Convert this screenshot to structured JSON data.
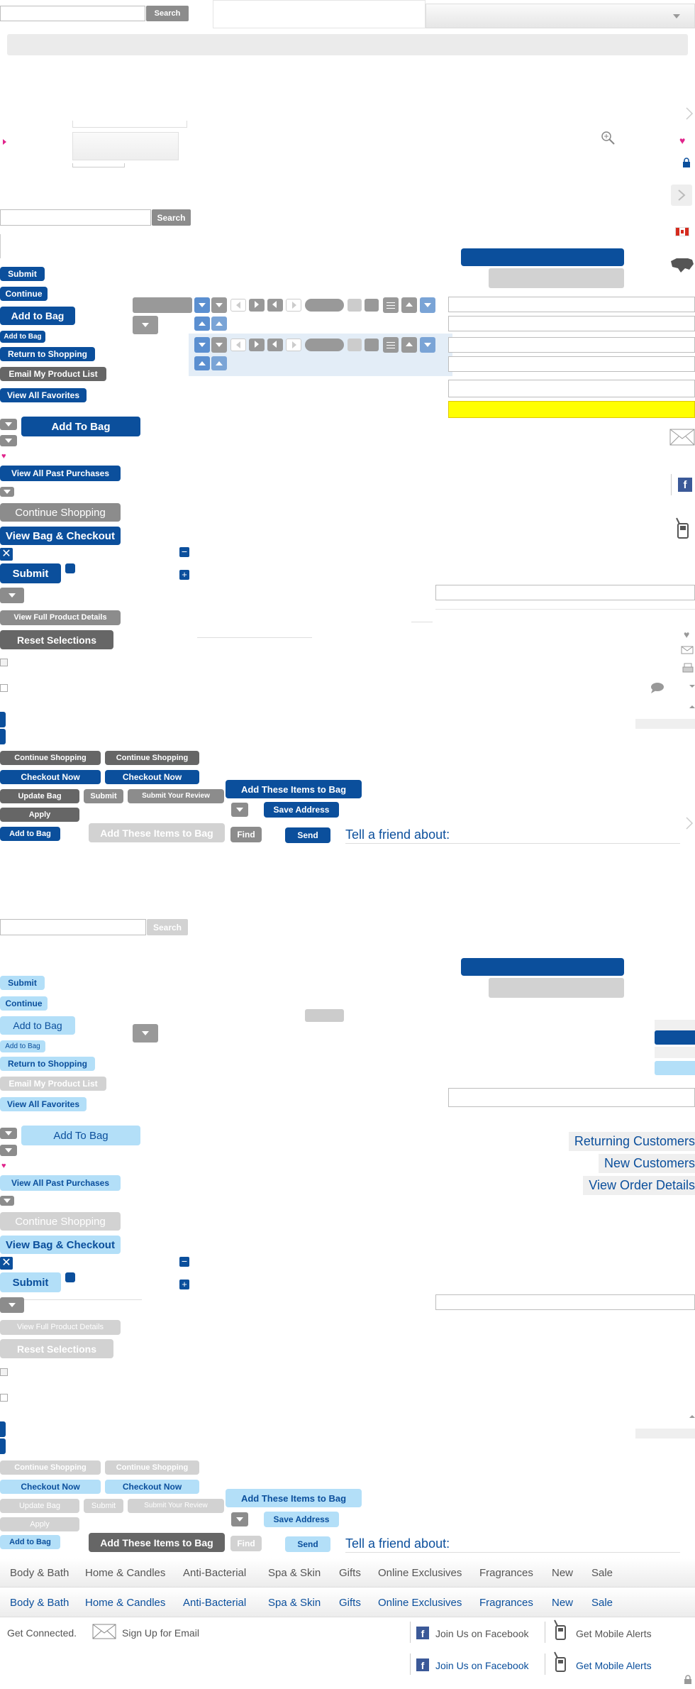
{
  "search": {
    "button": "Search"
  },
  "buttons_a": {
    "submit": "Submit",
    "continue": "Continue",
    "add_to_bag": "Add to Bag",
    "add_to_bag_small": "Add to Bag",
    "return_to_shopping": "Return to Shopping",
    "email_product_list": "Email My Product List",
    "view_all_favorites": "View All Favorites",
    "add_to_bag_big": "Add To Bag",
    "view_past_purchases": "View All Past Purchases",
    "continue_shopping": "Continue Shopping",
    "view_bag_checkout": "View Bag & Checkout",
    "submit2": "Submit",
    "view_full_details": "View Full Product Details",
    "reset_selections": "Reset Selections"
  },
  "row_buttons": {
    "continue_shopping": "Continue Shopping",
    "checkout_now": "Checkout Now",
    "update_bag": "Update Bag",
    "submit": "Submit",
    "submit_review": "Submit Your Review",
    "apply": "Apply",
    "add_to_bag": "Add to Bag",
    "add_these_items": "Add These Items to Bag",
    "save_address": "Save Address",
    "find": "Find",
    "send": "Send",
    "tell_friend": "Tell a friend about:"
  },
  "account_tabs": [
    "Returning Customers",
    "New Customers",
    "View Order Details"
  ],
  "nav_items": [
    "Body & Bath",
    "Home & Candles",
    "Anti-Bacterial",
    "Spa & Skin",
    "Gifts",
    "Online Exclusives",
    "Fragrances",
    "New",
    "Sale"
  ],
  "footer": {
    "get_connected": "Get Connected.",
    "email_signup": "Sign Up for Email",
    "facebook": "Join Us on Facebook",
    "mobile": "Get Mobile Alerts"
  },
  "colors": {
    "primary": "#0b4f9c",
    "gray": "#8c8c8c",
    "light_blue": "#b3dff8",
    "highlight": "#ffff00",
    "pink": "#e0258c"
  }
}
